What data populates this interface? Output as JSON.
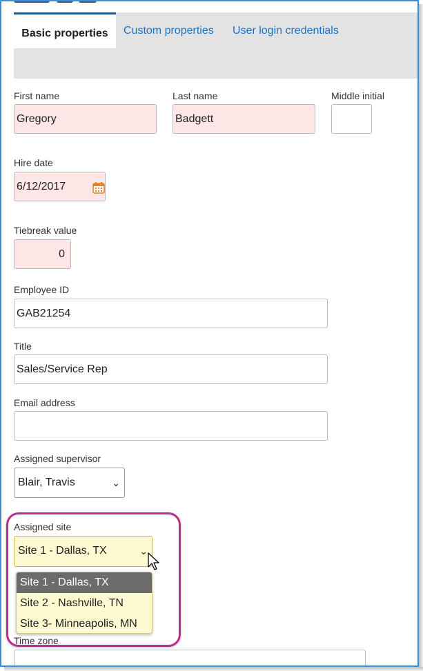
{
  "tabs": [
    {
      "label": "Basic properties",
      "active": true
    },
    {
      "label": "Custom properties",
      "active": false
    },
    {
      "label": "User login credentials",
      "active": false
    }
  ],
  "form": {
    "first_name": {
      "label": "First name",
      "value": "Gregory"
    },
    "last_name": {
      "label": "Last name",
      "value": "Badgett"
    },
    "middle_initial": {
      "label": "Middle initial",
      "value": ""
    },
    "hire_date": {
      "label": "Hire date",
      "value": "6/12/2017"
    },
    "tiebreak": {
      "label": "Tiebreak value",
      "value": "0"
    },
    "employee_id": {
      "label": "Employee ID",
      "value": "GAB21254"
    },
    "title": {
      "label": "Title",
      "value": "Sales/Service Rep"
    },
    "email": {
      "label": "Email address",
      "value": ""
    },
    "supervisor": {
      "label": "Assigned supervisor",
      "value": "Blair, Travis"
    },
    "site": {
      "label": "Assigned site",
      "value": "Site 1 - Dallas, TX",
      "options": [
        "Site 1 - Dallas, TX",
        "Site 2 - Nashville, TN",
        "Site 3- Minneapolis, MN"
      ]
    },
    "time_zone": {
      "label": "Time zone"
    }
  },
  "colors": {
    "accent_tab": "#1f5a8a",
    "link": "#1a73c2",
    "required_bg": "#fde6e6",
    "highlight": "#b92d8e",
    "dropdown_bg": "#fdf9d0"
  },
  "icons": [
    "calendar-icon",
    "chevron-down-icon",
    "mouse-cursor-icon"
  ]
}
